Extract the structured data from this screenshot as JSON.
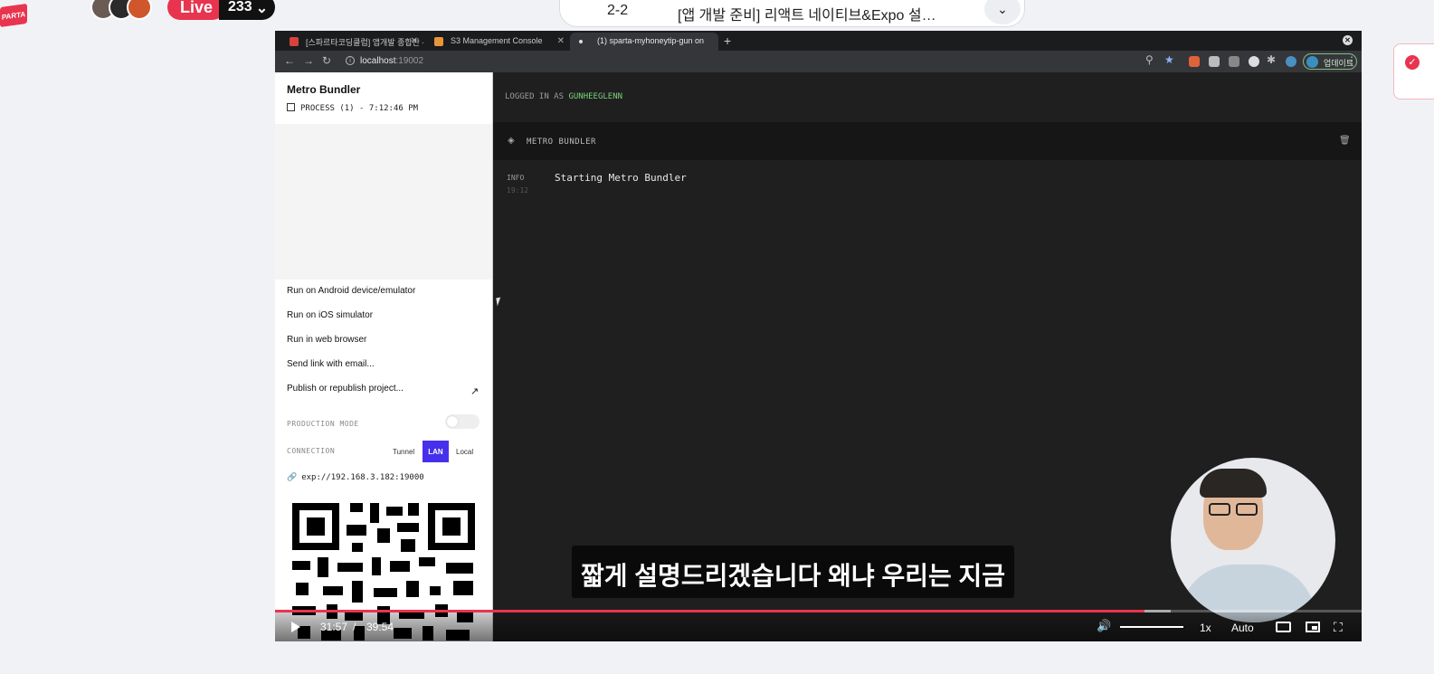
{
  "overlay": {
    "brand_text": "PARTA",
    "live_label": "Live",
    "viewer_count": "233",
    "lecture_number": "2-2",
    "lecture_title": "[앱 개발 준비] 리액트 네이티브&Expo 설…"
  },
  "browser": {
    "tabs": [
      {
        "title": "[스파르타코딩클럽] 앱개발 종합반 -"
      },
      {
        "title": "S3 Management Console"
      },
      {
        "title": "(1) sparta-myhoneytip-gun on"
      }
    ],
    "url_host": "localhost",
    "url_port": ":19002",
    "update_label": "업데이트"
  },
  "metro_left": {
    "title": "Metro Bundler",
    "process": "PROCESS (1) - 7:12:46 PM",
    "menu": [
      "Run on Android device/emulator",
      "Run on iOS simulator",
      "Run in web browser",
      "Send link with email...",
      "Publish or republish project..."
    ],
    "production_mode_label": "PRODUCTION MODE",
    "connection_label": "CONNECTION",
    "connection_options": [
      "Tunnel",
      "LAN",
      "Local"
    ],
    "selected_connection": "LAN",
    "exp_url": "exp://192.168.3.182:19000"
  },
  "metro_right": {
    "logged_in_prefix": "LOGGED IN AS",
    "username": "GUNHEEGLENN",
    "panel_title": "METRO BUNDLER",
    "log": {
      "level": "INFO",
      "time": "19:12",
      "message": "Starting Metro Bundler"
    }
  },
  "player": {
    "subtitle": "짧게 설명드리겠습니다 왜냐 우리는 지금",
    "current_time": "31:57",
    "separator": "/",
    "total_time": "39:54",
    "progress": 0.8,
    "speed": "1x",
    "quality": "Auto"
  },
  "colors": {
    "accent": "#e8344e",
    "lan_selected": "#4630eb",
    "username": "#7bd27b"
  }
}
